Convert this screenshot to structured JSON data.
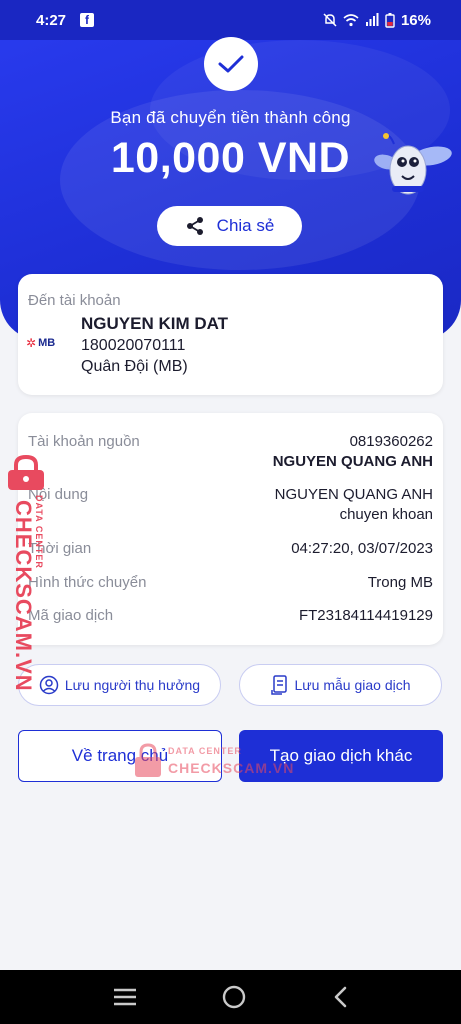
{
  "status_bar": {
    "time": "4:27",
    "battery": "16%",
    "fb_glyph": "f"
  },
  "result": {
    "message": "Bạn đã chuyển tiền thành công",
    "amount": "10,000 VND",
    "share_label": "Chia sẻ"
  },
  "destination": {
    "label": "Đến tài khoản",
    "bank_logo_text": "MB",
    "name": "NGUYEN KIM DAT",
    "account": "180020070111",
    "bank": "Quân Đội (MB)"
  },
  "details": {
    "source_label": "Tài khoản nguồn",
    "source_account": "0819360262",
    "source_name": "NGUYEN QUANG ANH",
    "content_label": "Nội dung",
    "content_line1": "NGUYEN QUANG ANH",
    "content_line2": "chuyen khoan",
    "time_label": "Thời gian",
    "time_value": "04:27:20, 03/07/2023",
    "method_label": "Hình thức chuyển",
    "method_value": "Trong MB",
    "txid_label": "Mã giao dịch",
    "txid_value": "FT23184114419129"
  },
  "actions": {
    "save_beneficiary": "Lưu người thụ hưởng",
    "save_template": "Lưu mẫu giao dịch",
    "home": "Về trang chủ",
    "new_transaction": "Tạo giao dịch khác"
  },
  "watermark": {
    "brand": "CHECKSCAM.VN",
    "sub": "DATA CENTER"
  },
  "colors": {
    "primary": "#1e2fd6",
    "watermark": "#e84a5f"
  },
  "icons": {
    "check": "check-icon",
    "share": "share-icon",
    "user": "user-circle-icon",
    "template": "document-icon",
    "menu": "menu-icon",
    "home": "home-circle-icon",
    "back": "back-icon"
  }
}
